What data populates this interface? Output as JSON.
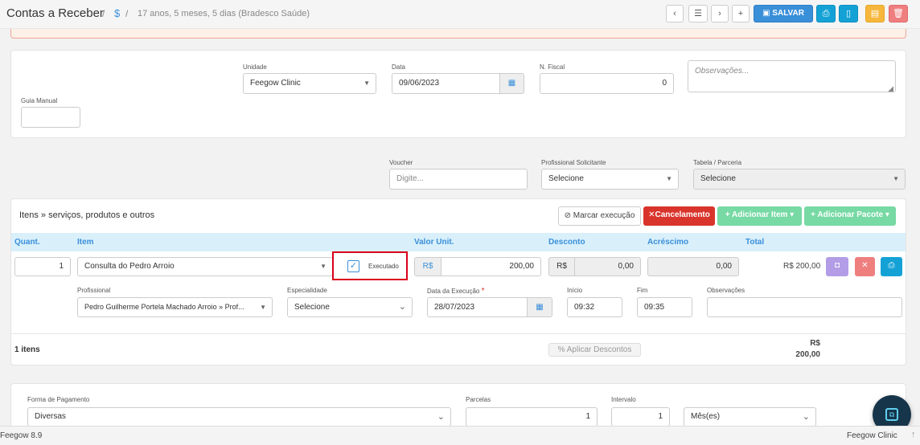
{
  "header": {
    "title": "Contas a Receber",
    "separator1": "/",
    "dollar": "$",
    "separator2": "/",
    "patient_info": "17 anos, 5 meses, 5 dias (Bradesco Saúde)",
    "save_label": "SALVAR"
  },
  "form1": {
    "unidade_label": "Unidade",
    "unidade_value": "Feegow Clinic",
    "data_label": "Data",
    "data_value": "09/06/2023",
    "nfiscal_label": "N. Fiscal",
    "nfiscal_value": "0",
    "observacoes_placeholder": "Observações...",
    "guia_label": "Guia Manual",
    "guia_value": ""
  },
  "form2": {
    "voucher_label": "Voucher",
    "voucher_placeholder": "Digite...",
    "profsol_label": "Profissional Solicitante",
    "profsol_value": "Selecione",
    "tabela_label": "Tabela / Parceria",
    "tabela_value": "Selecione"
  },
  "items": {
    "title": "Itens » serviços, produtos e outros",
    "marcar_label": "Marcar execução",
    "cancelamento_label": "Cancelamento",
    "add_item_label": "Adicionar Item",
    "add_pacote_label": "Adicionar Pacote",
    "columns": {
      "quant": "Quant.",
      "item": "Item",
      "valor": "Valor Unit.",
      "desconto": "Desconto",
      "acrescimo": "Acréscimo",
      "total": "Total"
    },
    "row": {
      "quant": "1",
      "item": "Consulta do Pedro Arroio",
      "executado_label": "Executado",
      "currency1": "R$",
      "valor": "200,00",
      "currency2": "R$",
      "desconto": "0,00",
      "acrescimo": "0,00",
      "total": "R$ 200,00"
    },
    "detail": {
      "profissional_label": "Profissional",
      "profissional_value": "Pedro Guilherme Portela Machado Arroio » Prof...",
      "especialidade_label": "Especialidade",
      "especialidade_value": "Selecione",
      "data_exec_label": "Data da Execução",
      "required_mark": "*",
      "data_exec_value": "28/07/2023",
      "inicio_label": "Início",
      "inicio_value": "09:32",
      "fim_label": "Fim",
      "fim_value": "09:35",
      "obs_label": "Observações",
      "obs_value": ""
    },
    "footer": {
      "count": "1 itens",
      "aplicar_label": "Aplicar Descontos",
      "total_currency": "R$",
      "total_value": "200,00"
    }
  },
  "payment": {
    "forma_label": "Forma de Pagamento",
    "forma_value": "Diversas",
    "parcelas_label": "Parcelas",
    "parcelas_value": "1",
    "intervalo_label": "Intervalo",
    "intervalo_value": "1",
    "periodo_value": "Mês(es)"
  },
  "footer": {
    "version": "Feegow 8.9",
    "brand": "Feegow Clinic"
  },
  "colors": {
    "primary": "#3a8fd9",
    "cancel": "#d9342b",
    "add": "#77d9a4",
    "highlight": "#d9001b"
  }
}
